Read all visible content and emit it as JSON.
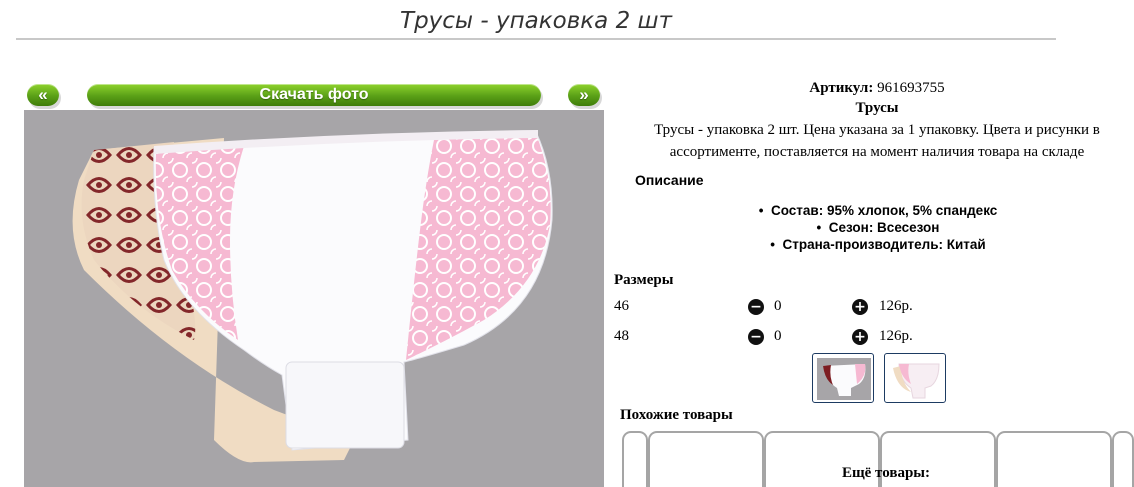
{
  "page": {
    "title": "Трусы - упаковка 2 шт"
  },
  "gallery": {
    "prev_label": "«",
    "next_label": "»",
    "download_label": "Скачать фото",
    "main_image_icon": "product-photo-panties",
    "thumbnails": [
      {
        "icon": "thumb-panties-gray",
        "selected": true
      },
      {
        "icon": "thumb-panties-pink",
        "selected": false
      }
    ]
  },
  "product": {
    "sku_label": "Артикул:",
    "sku_value": "961693755",
    "name": "Трусы",
    "description": "Трусы - упаковка 2 шт. Цена указана за 1 упаковку. Цвета и рисунки в ассортименте, поставляется на момент наличия товара на складе",
    "description_title": "Описание",
    "specs": [
      "Состав: 95% хлопок, 5% спандекс",
      "Сезон: Всесезон",
      "Страна-производитель: Китай"
    ]
  },
  "sizes": {
    "title": "Размеры",
    "minus_icon": "minus-circle-icon",
    "plus_icon": "plus-circle-icon",
    "rows": [
      {
        "size": "46",
        "qty": "0",
        "price": "126р."
      },
      {
        "size": "48",
        "qty": "0",
        "price": "126р."
      }
    ]
  },
  "similar": {
    "title": "Похожие товары",
    "more_title": "Ещё товары:"
  },
  "colors": {
    "accent_green": "#5aa017",
    "photo_background": "#a7a5a8",
    "thumb_border": "#1d3b62"
  }
}
